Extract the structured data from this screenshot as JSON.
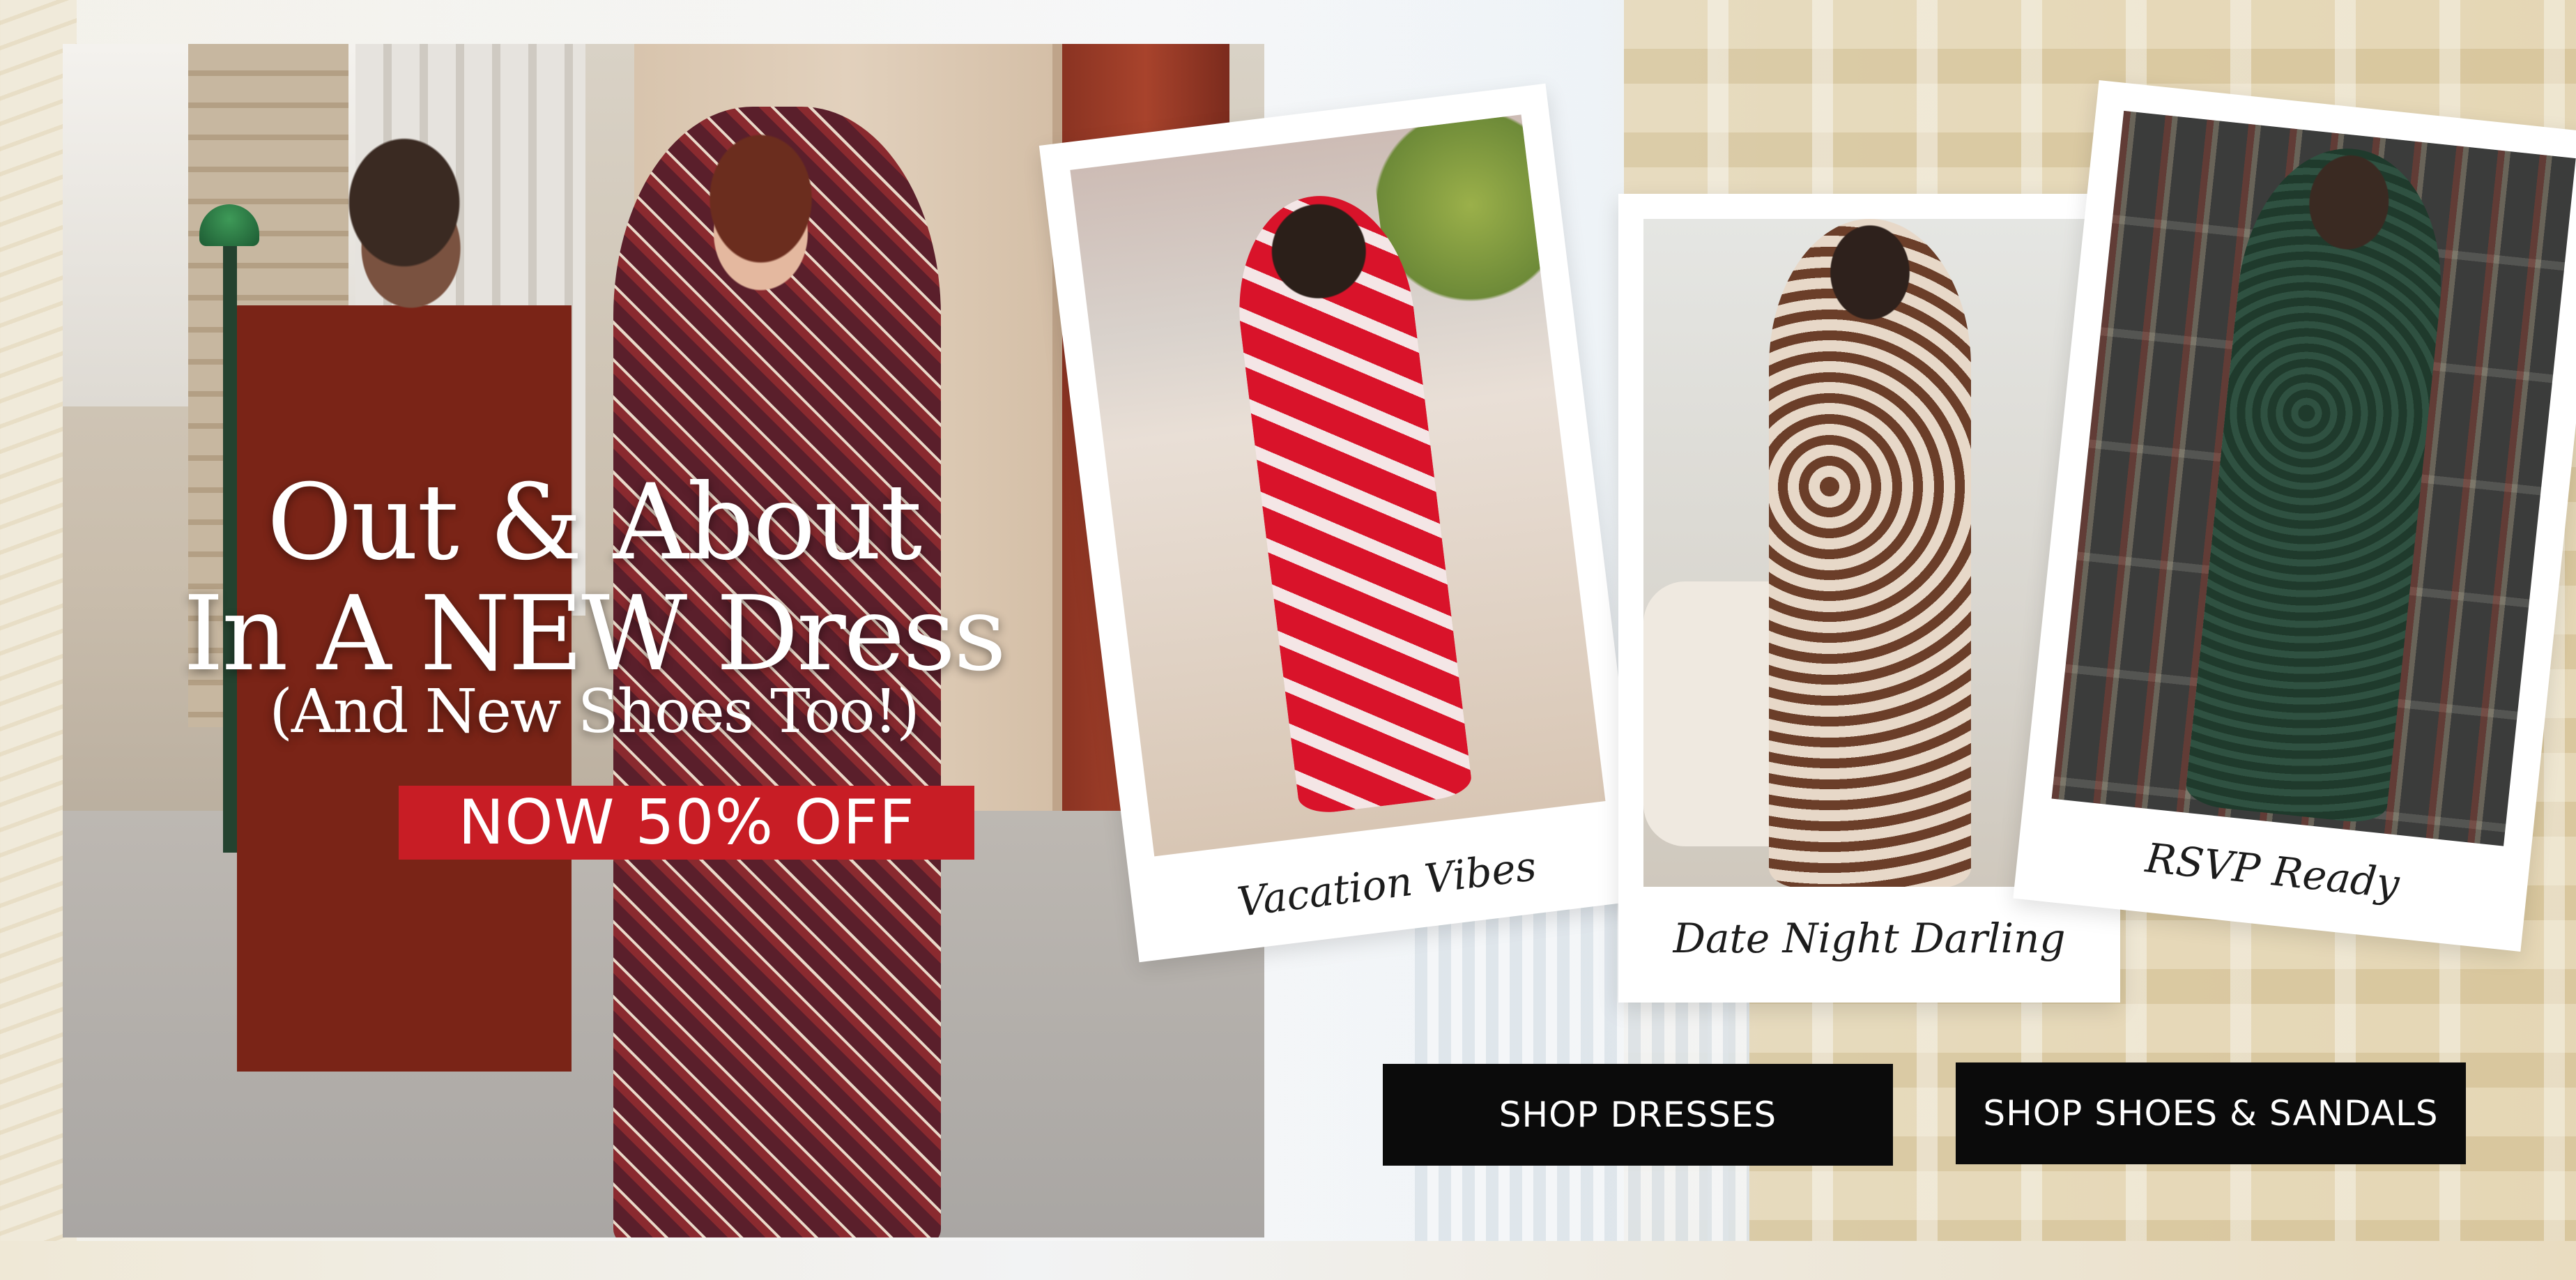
{
  "hero": {
    "headline_line1": "Out & About",
    "headline_line2": "In A NEW Dress",
    "headline_line3": "(And New Shoes Too!)",
    "promo_text": "NOW 50% OFF"
  },
  "cards": [
    {
      "caption": "Vacation Vibes"
    },
    {
      "caption": "Date Night Darling"
    },
    {
      "caption": "RSVP Ready"
    }
  ],
  "buttons": {
    "shop_dresses": "SHOP DRESSES",
    "shop_shoes": "SHOP SHOES & SANDALS"
  },
  "colors": {
    "promo_red": "#c81d25",
    "button_black": "#0b0b0b"
  }
}
